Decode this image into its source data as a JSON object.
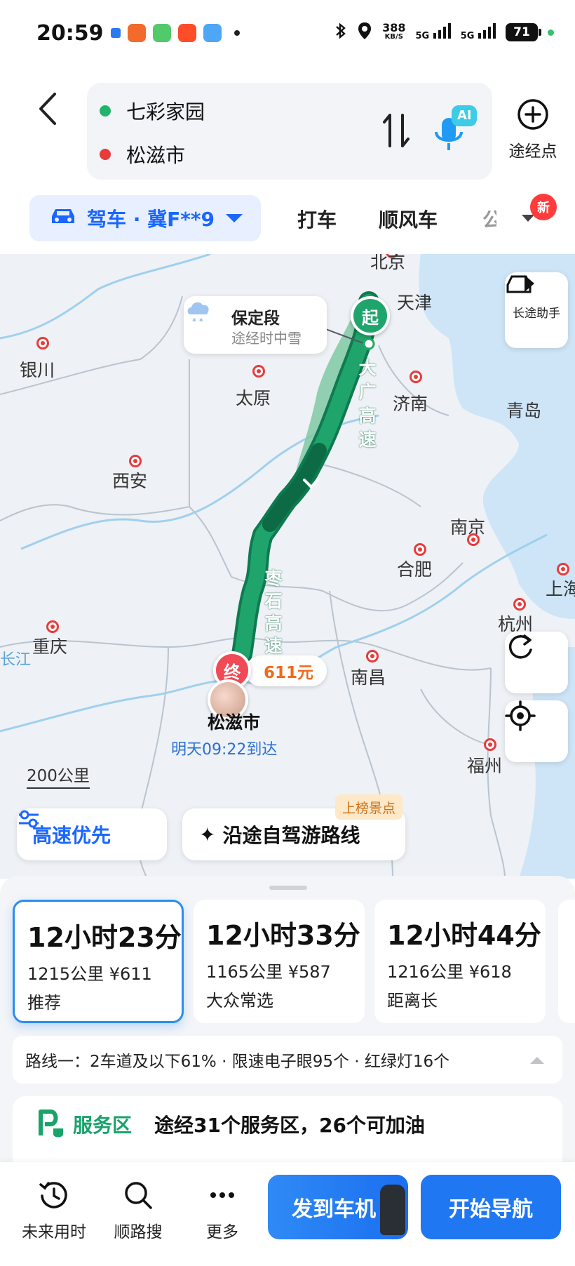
{
  "status_bar": {
    "time": "20:59",
    "speed_value": "388",
    "speed_unit": "KB/S",
    "signal_1": "5G",
    "signal_2": "5G",
    "battery": "71"
  },
  "route": {
    "origin": "七彩家园",
    "destination": "松滋市",
    "waypoint_label": "途经点",
    "ai_badge": "AI"
  },
  "modes": {
    "drive": "驾车 · 冀F**9",
    "taxi": "打车",
    "carpool": "顺风车",
    "cut_item": "公",
    "new_badge": "新"
  },
  "map": {
    "cities": {
      "beijing": "北京",
      "tianjin": "天津",
      "yinchuan": "银川",
      "taiyuan": "太原",
      "jinan": "济南",
      "qingdao": "青岛",
      "xian": "西安",
      "nanjing": "南京",
      "hefei": "合肥",
      "shanghai": "上海",
      "hangzhou": "杭州",
      "chongqing": "重庆",
      "nanchang": "南昌",
      "fuzhou": "福州",
      "tianjin_edge": "天",
      "yangtze": "长江",
      "sea_edge": "海"
    },
    "weather_title": "保定段",
    "weather_sub": "途经时中雪",
    "start_label": "起",
    "end_label": "终",
    "toll": "611元",
    "dest_city": "松滋市",
    "arrival": "明天09:22到达",
    "road_1": [
      "大",
      "广",
      "高",
      "速"
    ],
    "road_2": [
      "枣",
      "石",
      "高",
      "速"
    ],
    "scale": "200公里",
    "long_trip_helper": "长途助手",
    "chip_highway": "高速优先",
    "chip_tour": "沿途自驾游路线",
    "chip_badge": "上榜景点"
  },
  "route_options": [
    {
      "time": "12小时23分",
      "meta": "1215公里  ¥611",
      "tag": "推荐"
    },
    {
      "time": "12小时33分",
      "meta": "1165公里  ¥587",
      "tag": "大众常选"
    },
    {
      "time": "12小时44分",
      "meta": "1216公里  ¥618",
      "tag": "距离长"
    }
  ],
  "route_info": "路线一：2车道及以下61% · 限速电子眼95个 · 红绿灯16个",
  "service": {
    "label": "服务区",
    "text": "途经31个服务区，26个可加油"
  },
  "bottom_bar": {
    "future_time": "未来用时",
    "along_search": "顺路搜",
    "more": "更多",
    "send_car": "发到车机",
    "start_nav": "开始导航"
  },
  "colors": {
    "accent_blue": "#1a66ff",
    "route_green": "#1fa56c",
    "end_red": "#ef4a55",
    "toll_orange": "#f06a1c"
  }
}
